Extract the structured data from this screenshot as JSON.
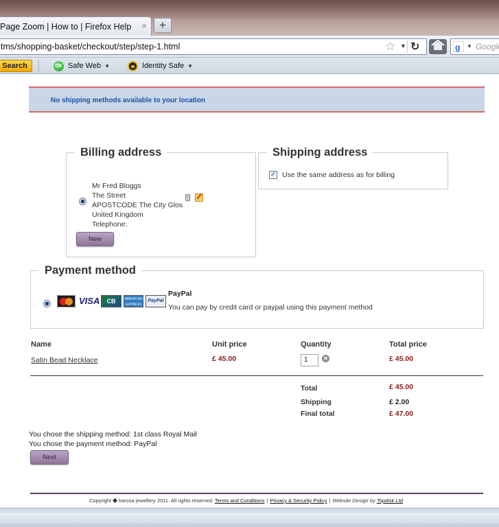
{
  "browser": {
    "tab_title": "Page Zoom | How to | Firefox Help",
    "tab_close": "×",
    "new_tab": "+",
    "url": "tms/shopping-basket/checkout/step/step-1.html",
    "search_placeholder": "Google",
    "toolbar": {
      "search_label": "Search",
      "safe_web_label": "Safe Web",
      "safe_web_badge": "OK",
      "identity_safe_label": "Identity Safe"
    }
  },
  "notice": "No shipping methods available to your location",
  "billing": {
    "title": "Billing address",
    "address_lines": [
      "Mr Fred Bloggs",
      "The Street",
      "APOSTCODE The City Glos",
      "United Kingdom",
      "Telephone:"
    ],
    "new_button": "New"
  },
  "shipping": {
    "title": "Shipping address",
    "same_as_billing_label": "Use the same address as for billing",
    "same_as_billing_checked": true
  },
  "payment": {
    "title": "Payment method",
    "cards": [
      "mastercard",
      "VISA",
      "CB",
      "AMERICAN EXPRESS",
      "PayPal"
    ],
    "option_title": "PayPal",
    "option_desc": "You can pay by credit card or paypal using this payment method"
  },
  "basket": {
    "headers": {
      "name": "Name",
      "unit_price": "Unit price",
      "quantity": "Quantity",
      "total_price": "Total price"
    },
    "items": [
      {
        "name": "Satin Bead Necklace",
        "unit_price": "£ 45.00",
        "quantity": "1",
        "total_price": "£ 45.00"
      }
    ],
    "summary": {
      "total_label": "Total",
      "total": "£ 45.00",
      "shipping_label": "Shipping",
      "shipping": "£ 2.00",
      "final_label": "Final total",
      "final": "£ 47.00"
    }
  },
  "choices": {
    "shipping_line": "You chose the shipping method: 1st class Royal Mail",
    "payment_line": "You chose the payment method: PayPal"
  },
  "next_button": "Next",
  "footer": {
    "copyright_start": "Copyright",
    "copyright_rest": "karosa jewellery 2011. All rights reserved.",
    "terms": "Terms and Conditions",
    "privacy": "Privacy & Security Policy",
    "design_prefix": "Website Design by",
    "designer": "Topdisk Ltd"
  },
  "colors": {
    "accent_button": "#a58fb0",
    "price": "#8b1a1a",
    "notice_bg": "#c8d6e8",
    "notice_text": "#1b53a6"
  }
}
